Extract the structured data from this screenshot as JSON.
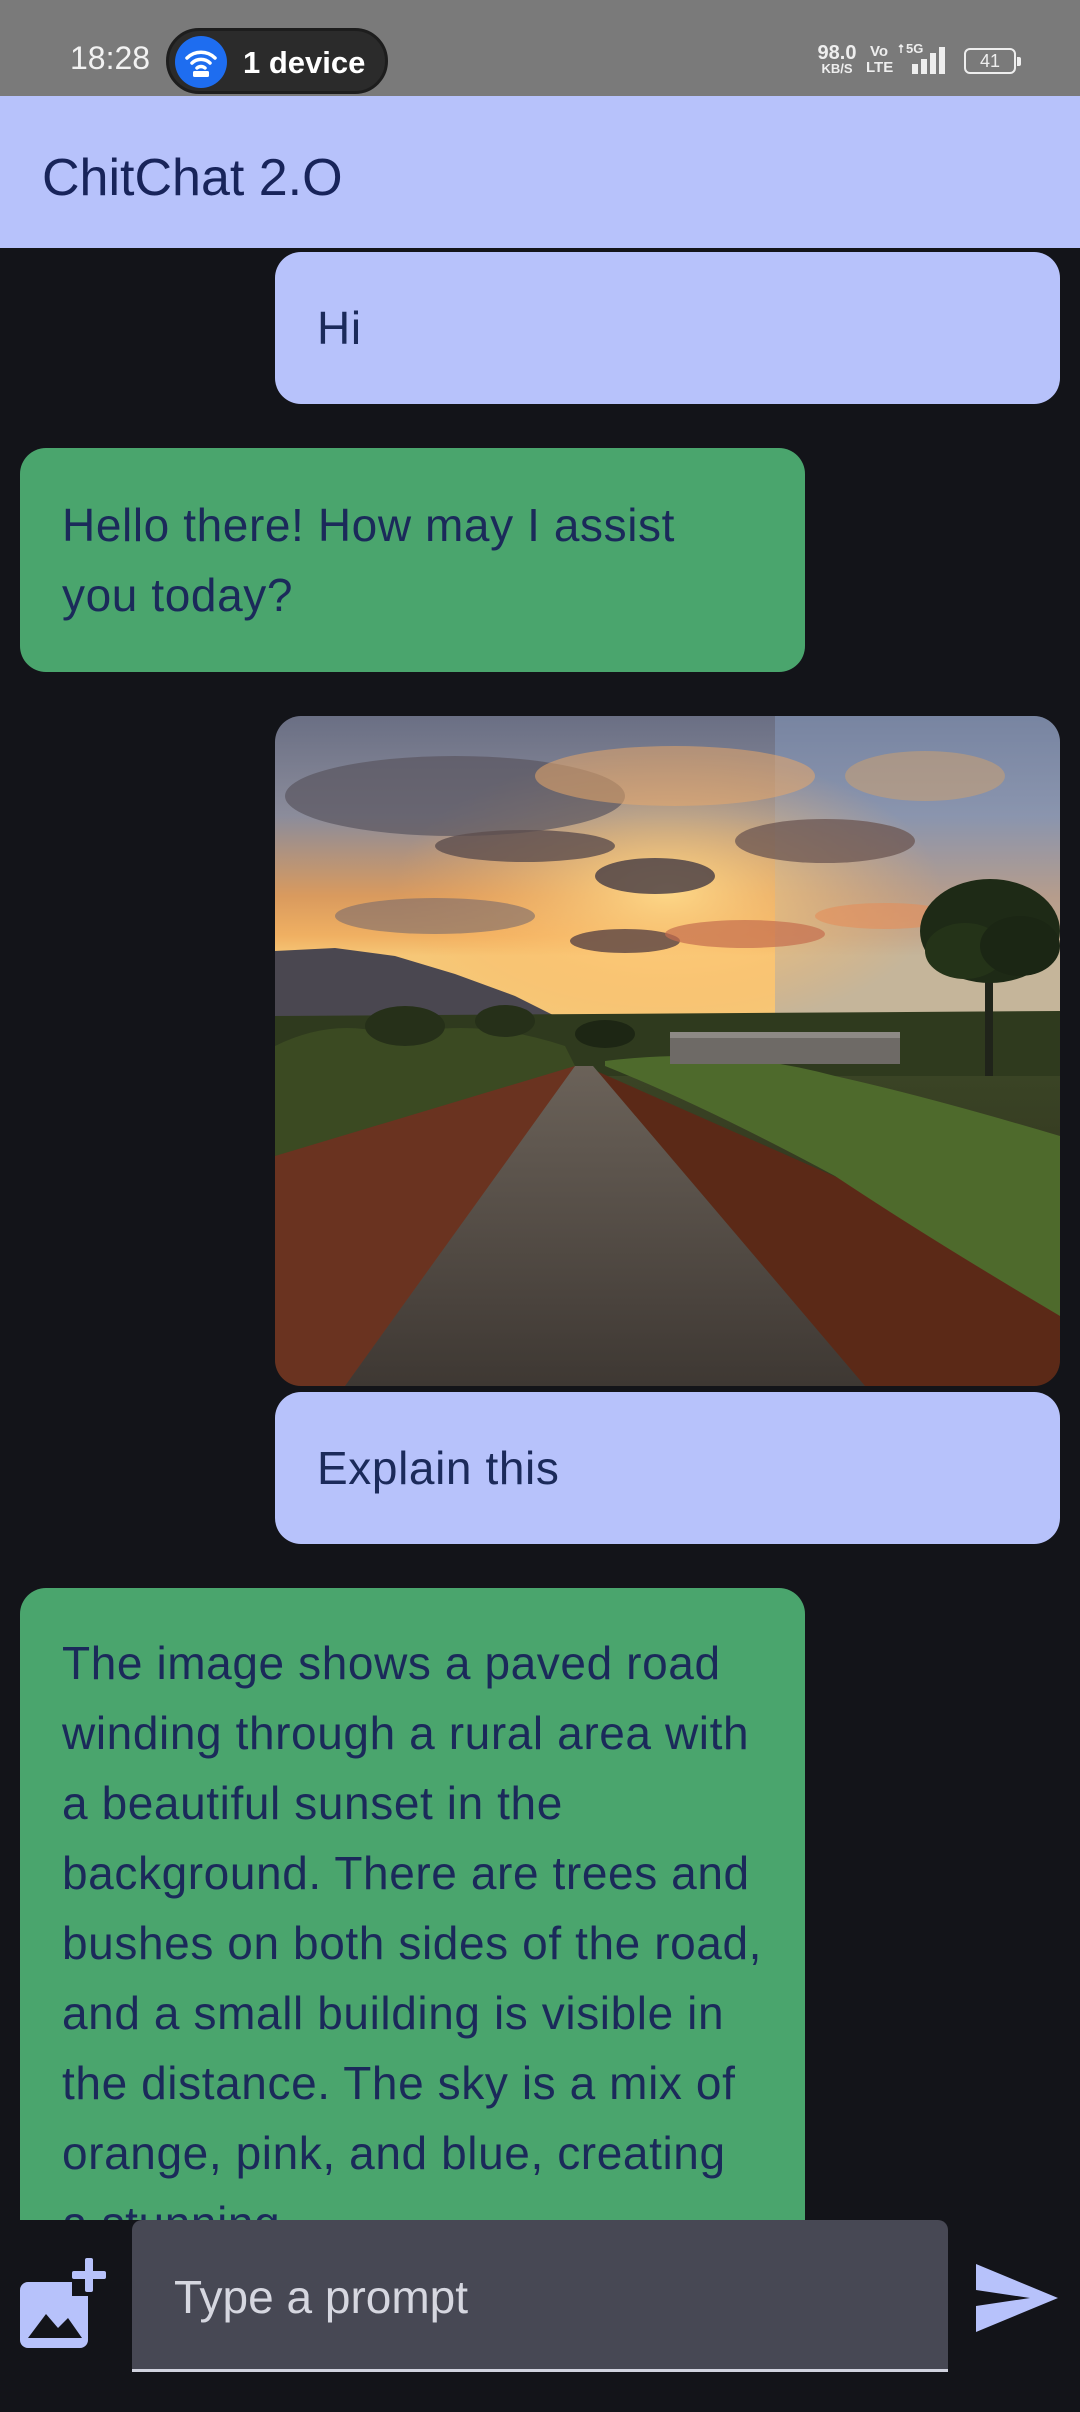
{
  "status_bar": {
    "time": "18:28",
    "hotspot_label": "1 device",
    "net_speed_value": "98.0",
    "net_speed_unit": "KB/S",
    "volte_top": "Vo",
    "volte_bottom": "LTE",
    "network_type": "5G",
    "battery": "41",
    "icons": [
      "hotspot-icon",
      "signal-icon",
      "battery-icon"
    ]
  },
  "app_bar": {
    "title": "ChitChat 2.O"
  },
  "messages": [
    {
      "role": "user",
      "text": "Hi"
    },
    {
      "role": "bot",
      "text": "Hello there! How may I assist you today?"
    },
    {
      "role": "user",
      "type": "image",
      "icon": "landscape-photo"
    },
    {
      "role": "user",
      "text": "Explain this"
    },
    {
      "role": "bot",
      "text": "The image shows a paved road winding through a rural area with a beautiful sunset in the background. There are trees and bushes on both sides of the road, and a small building is visible in the distance. The sky is a mix of orange, pink, and blue, creating a stunning"
    }
  ],
  "input": {
    "placeholder": "Type a prompt",
    "add_image_icon": "add-image-icon",
    "send_icon": "send-icon"
  },
  "colors": {
    "background": "#131419",
    "app_bar": "#b7c2fb",
    "user_bubble": "#b7c2fb",
    "bot_bubble": "#4aa56d",
    "text_dark": "#1b2a5a",
    "input_bg": "#474854"
  }
}
